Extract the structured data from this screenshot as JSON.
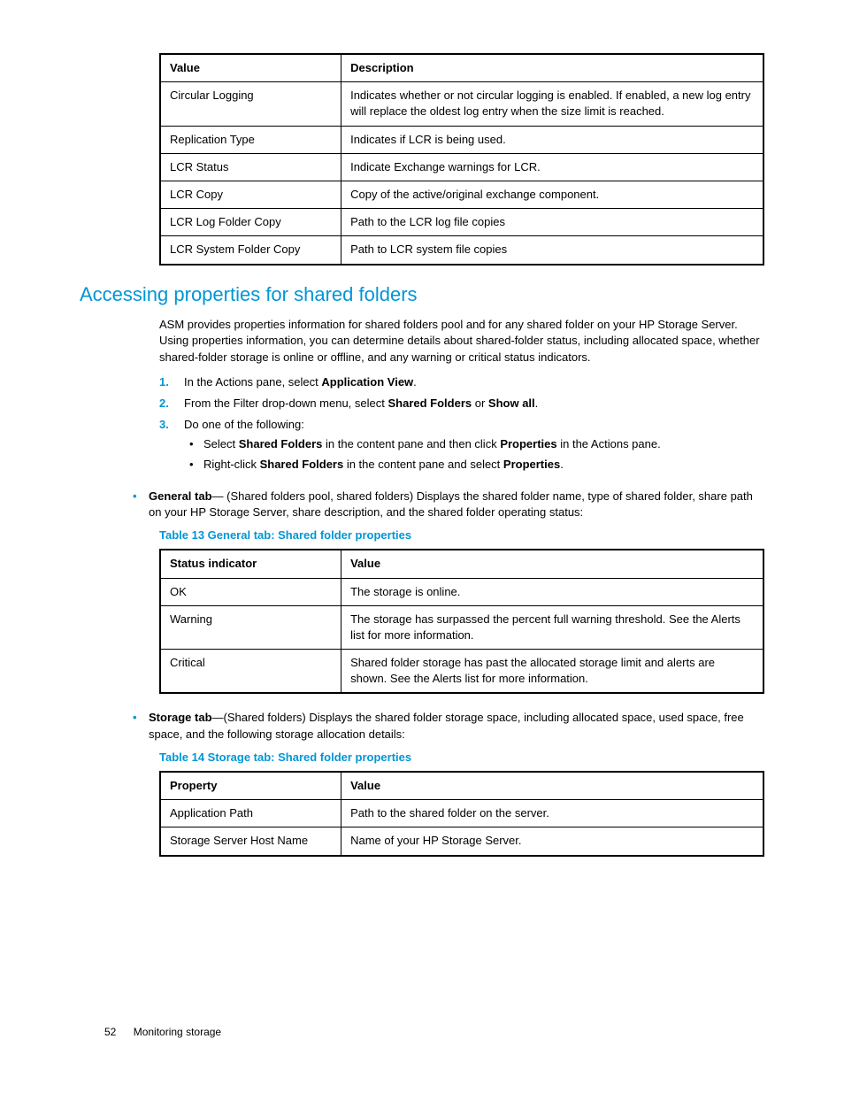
{
  "table1": {
    "headers": [
      "Value",
      "Description"
    ],
    "rows": [
      [
        "Circular Logging",
        "Indicates whether or not circular logging is enabled. If enabled, a new log entry will replace the oldest log entry when the size limit is reached."
      ],
      [
        "Replication Type",
        "Indicates if LCR is being used."
      ],
      [
        "LCR Status",
        "Indicate Exchange warnings for LCR."
      ],
      [
        "LCR Copy",
        "Copy of the active/original exchange component."
      ],
      [
        "LCR Log Folder Copy",
        "Path to the LCR log file copies"
      ],
      [
        "LCR System Folder Copy",
        "Path to LCR system file copies"
      ]
    ]
  },
  "section": {
    "heading": "Accessing properties for shared folders",
    "intro": "ASM provides properties information for shared folders pool and for any shared folder on your HP Storage Server. Using properties information, you can determine details about shared-folder status, including allocated space, whether shared-folder storage is online or offline, and any warning or critical status indicators.",
    "steps": {
      "s1a": "In the Actions pane, select ",
      "s1b": "Application View",
      "s1c": ".",
      "s2a": "From the Filter drop-down menu, select ",
      "s2b": "Shared Folders",
      "s2c": " or ",
      "s2d": "Show all",
      "s2e": ".",
      "s3": "Do one of the following:",
      "s3_b1a": "Select ",
      "s3_b1b": "Shared Folders",
      "s3_b1c": " in the content pane and then click ",
      "s3_b1d": "Properties",
      "s3_b1e": " in the Actions pane.",
      "s3_b2a": "Right-click ",
      "s3_b2b": "Shared Folders",
      "s3_b2c": " in the content pane and select ",
      "s3_b2d": "Properties",
      "s3_b2e": "."
    },
    "general_tab": {
      "label": "General tab",
      "text": "— (Shared folders pool, shared folders) Displays the shared folder name, type of shared folder, share path on your HP Storage Server, share description, and the shared folder operating status:"
    },
    "table13_caption": "Table 13 General tab: Shared folder properties",
    "table13": {
      "headers": [
        "Status indicator",
        "Value"
      ],
      "rows": [
        [
          "OK",
          "The storage is online."
        ],
        [
          "Warning",
          "The storage has surpassed the percent full warning threshold. See the Alerts list for more information."
        ],
        [
          "Critical",
          "Shared folder storage has past the allocated storage limit and alerts are shown. See the Alerts list for more information."
        ]
      ]
    },
    "storage_tab": {
      "label": "Storage tab",
      "text": "—(Shared folders) Displays the shared folder storage space, including allocated space, used space, free space, and the following storage allocation details:"
    },
    "table14_caption": "Table 14 Storage tab: Shared folder properties",
    "table14": {
      "headers": [
        "Property",
        "Value"
      ],
      "rows": [
        [
          "Application Path",
          "Path to the shared folder on the server."
        ],
        [
          "Storage Server Host Name",
          "Name of your HP Storage Server."
        ]
      ]
    }
  },
  "footer": {
    "page": "52",
    "title": "Monitoring storage"
  }
}
